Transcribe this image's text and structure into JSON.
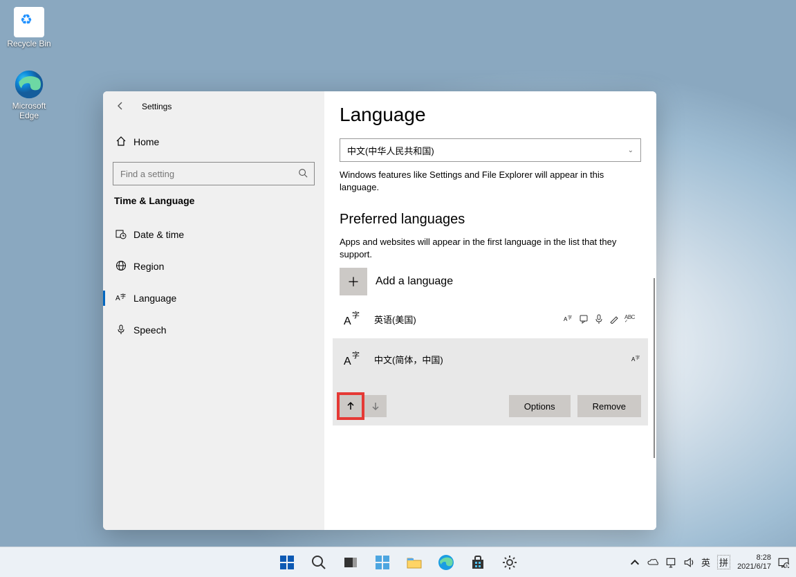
{
  "desktop": {
    "recycle_bin": "Recycle Bin",
    "edge": "Microsoft Edge"
  },
  "window": {
    "title": "Settings",
    "search_placeholder": "Find a setting",
    "nav": {
      "home": "Home",
      "section": "Time & Language",
      "date_time": "Date & time",
      "region": "Region",
      "language": "Language",
      "speech": "Speech"
    }
  },
  "page": {
    "heading": "Language",
    "display_lang": "中文(中华人民共和国)",
    "display_desc": "Windows features like Settings and File Explorer will appear in this language.",
    "pref_heading": "Preferred languages",
    "pref_desc": "Apps and websites will appear in the first language in the list that they support.",
    "add_lang": "Add a language",
    "langs": [
      {
        "name": "英语(美国)",
        "features": [
          "display",
          "tts",
          "voice",
          "handwrite",
          "spell"
        ]
      },
      {
        "name": "中文(简体，中国)",
        "features": [
          "display"
        ]
      }
    ],
    "options_btn": "Options",
    "remove_btn": "Remove"
  },
  "taskbar": {
    "ime1": "英",
    "ime2": "拼",
    "time": "8:28",
    "date": "2021/6/17"
  }
}
